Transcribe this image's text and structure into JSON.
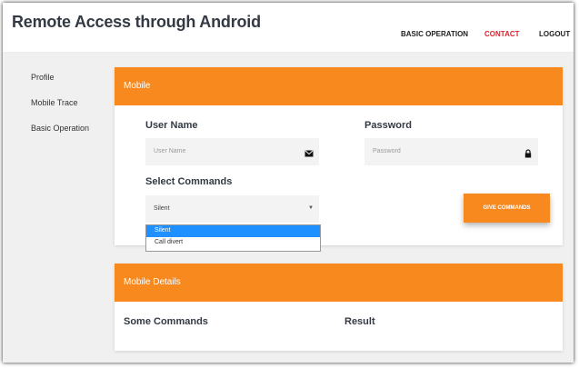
{
  "app_title": "Remote Access through Android",
  "nav": {
    "basic_operation": "BASIC OPERATION",
    "contact": "CONTACT",
    "logout": "LOGOUT",
    "active_color": "#e8202a"
  },
  "sidebar": {
    "items": [
      {
        "label": "Profile"
      },
      {
        "label": "Mobile Trace"
      },
      {
        "label": "Basic Operation"
      }
    ]
  },
  "mobile_card": {
    "title": "Mobile",
    "user_name": {
      "label": "User Name",
      "placeholder": "User Name",
      "value": "",
      "icon": "envelope-icon"
    },
    "password": {
      "label": "Password",
      "placeholder": "Password",
      "value": "",
      "icon": "lock-icon"
    },
    "select_commands": {
      "label": "Select Commands",
      "selected": "Silent",
      "options": [
        "Silent",
        "Call divert"
      ],
      "highlighted": "Silent"
    },
    "give_commands_label": "GIVE COMMANDS"
  },
  "details_card": {
    "title": "Mobile Details",
    "col_commands": "Some Commands",
    "col_result": "Result"
  },
  "colors": {
    "accent": "#f7891f",
    "highlight": "#1e90ff",
    "background": "#f0f0f0"
  }
}
